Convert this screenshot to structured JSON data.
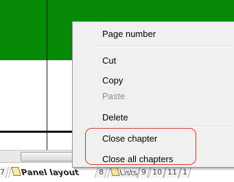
{
  "context_menu": {
    "items": [
      {
        "label": "Page number",
        "enabled": true
      },
      {
        "label": "Cut",
        "enabled": true
      },
      {
        "label": "Copy",
        "enabled": true
      },
      {
        "label": "Paste",
        "enabled": false
      },
      {
        "label": "Delete",
        "enabled": true
      },
      {
        "label": "Close chapter",
        "enabled": true
      },
      {
        "label": "Close all chapters",
        "enabled": true
      }
    ]
  },
  "tabs": {
    "t7": "7",
    "panel_layout": "Panel layout",
    "t8": "8",
    "lists": "Lists",
    "t9": "9",
    "t10": "10",
    "t11": "11",
    "t1x": "1"
  },
  "colors": {
    "canvas_green": "#078a07",
    "highlight": "#e0302a"
  }
}
